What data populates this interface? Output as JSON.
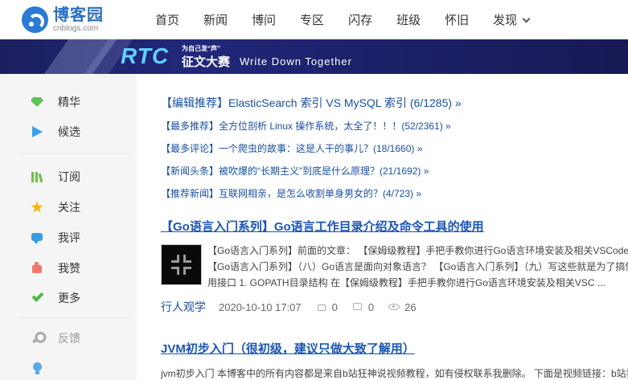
{
  "header": {
    "logo_title": "博客园",
    "logo_sub": "cnblogs.com",
    "nav": [
      "首页",
      "新闻",
      "博问",
      "专区",
      "闪存",
      "班级",
      "怀旧",
      "发现"
    ]
  },
  "banner": {
    "rtc": "RTC",
    "small": "为自己发“声”",
    "title": "征文大赛",
    "english": "Write Down Together"
  },
  "sidebar": {
    "items": [
      {
        "label": "精华",
        "icon": "gem-icon"
      },
      {
        "label": "候选",
        "icon": "play-icon"
      },
      {
        "label": "订阅",
        "icon": "books-icon"
      },
      {
        "label": "关注",
        "icon": "star-icon"
      },
      {
        "label": "我评",
        "icon": "comment-icon"
      },
      {
        "label": "我赞",
        "icon": "thumb-up-icon"
      },
      {
        "label": "更多",
        "icon": "check-icon"
      },
      {
        "label": "反馈",
        "icon": "wrench-icon"
      }
    ]
  },
  "recommendations": [
    "【编辑推荐】ElasticSearch 索引 VS MySQL 索引 (6/1285) »",
    "【最多推荐】全方位剖析 Linux 操作系统，太全了！！！(52/2361) »",
    "【最多评论】一个爬虫的故事：这是人干的事儿？(18/1660) »",
    "【新闻头条】被吹爆的“长期主义”到底是什么原理？(21/1692) »",
    "【推荐新闻】互联网相亲，是怎么收割单身男女的？(4/723) »"
  ],
  "posts": [
    {
      "title": "【Go语言入门系列】Go语言工作目录介绍及命令工具的使用",
      "summary": "【Go语言入门系列】前面的文章： 【保姆级教程】手把手教你进行Go语言环境安装及相关VSCode配置 【Go语言入门系列】（八）Go语言是面向对象语言？ 【Go语言入门系列】（九）写这些就是为了搞懂怎么用接口 1. GOPATH目录结构 在【保姆级教程】手把手教你进行Go语言环境安装及相关VSC ...",
      "author": "行人观学",
      "date": "2020-10-10 17:07",
      "likes": "0",
      "comments": "0",
      "views": "26"
    },
    {
      "title": "JVM初步入门（很初级，建议只做大致了解用）",
      "summary": "jvm初步入门 本博客中的所有内容都是来自b站狂神说视频教程，如有侵权联系我删除。 下面是视频链接：b站狂神说"
    }
  ]
}
